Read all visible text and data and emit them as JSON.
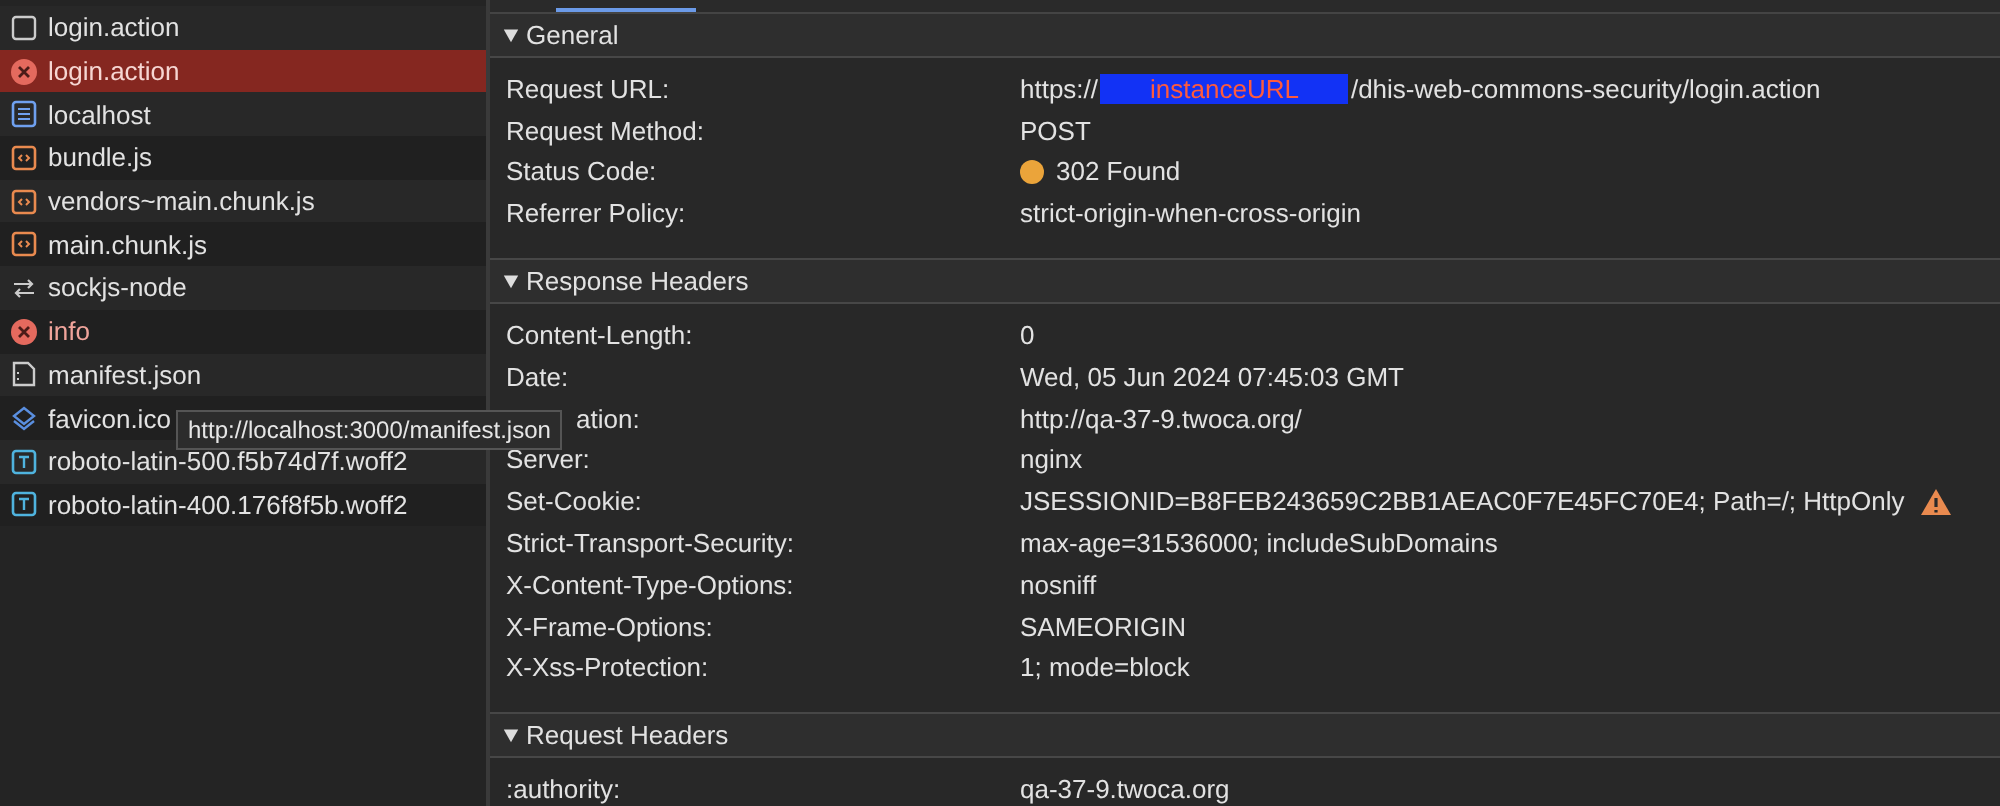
{
  "requests": [
    {
      "name": "login.action",
      "kind": "blank",
      "error": false,
      "selected": false
    },
    {
      "name": "login.action",
      "kind": "error",
      "error": true,
      "selected": true
    },
    {
      "name": "localhost",
      "kind": "document",
      "error": false,
      "selected": false
    },
    {
      "name": "bundle.js",
      "kind": "script",
      "error": false,
      "selected": false
    },
    {
      "name": "vendors~main.chunk.js",
      "kind": "script",
      "error": false,
      "selected": false
    },
    {
      "name": "main.chunk.js",
      "kind": "script",
      "error": false,
      "selected": false
    },
    {
      "name": "sockjs-node",
      "kind": "websocket",
      "error": false,
      "selected": false
    },
    {
      "name": "info",
      "kind": "error",
      "error": true,
      "selected": false
    },
    {
      "name": "manifest.json",
      "kind": "manifest",
      "error": false,
      "selected": false
    },
    {
      "name": "favicon.ico",
      "kind": "layers",
      "error": false,
      "selected": false
    },
    {
      "name": "roboto-latin-500.f5b74d7f.woff2",
      "kind": "font",
      "error": false,
      "selected": false
    },
    {
      "name": "roboto-latin-400.176f8f5b.woff2",
      "kind": "font",
      "error": false,
      "selected": false
    }
  ],
  "tooltip": "http://localhost:3000/manifest.json",
  "sections": [
    {
      "title": "General",
      "expanded": true,
      "rows": [
        {
          "label": "Request URL:",
          "segments": [
            {
              "text": "https://",
              "redacted": false
            },
            {
              "text": "instanceURL",
              "redacted": true
            },
            {
              "text": "/dhis-web-commons-security/login.action",
              "redacted": false
            }
          ]
        },
        {
          "label": "Request Method:",
          "value": "POST"
        },
        {
          "label": "Status Code:",
          "value": "302 Found",
          "color": "#eba43a"
        },
        {
          "label": "Referrer Policy:",
          "value": "strict-origin-when-cross-origin"
        }
      ]
    },
    {
      "title": "Response Headers",
      "expanded": true,
      "rows": [
        {
          "label": "Content-Length:",
          "value": "0"
        },
        {
          "label": "Date:",
          "value": "Wed, 05 Jun 2024 07:45:03 GMT"
        },
        {
          "label": "ation:",
          "value": "http://qa-37-9.twoca.org/",
          "obscured": true
        },
        {
          "label": "Server:",
          "value": "nginx"
        },
        {
          "label": "Set-Cookie:",
          "value": "JSESSIONID=B8FEB243659C2BB1AEAC0F7E45FC70E4; Path=/; HttpOnly",
          "warning": true
        },
        {
          "label": "Strict-Transport-Security:",
          "value": "max-age=31536000; includeSubDomains"
        },
        {
          "label": "X-Content-Type-Options:",
          "value": "nosniff"
        },
        {
          "label": "X-Frame-Options:",
          "value": "SAMEORIGIN"
        },
        {
          "label": "X-Xss-Protection:",
          "value": "1; mode=block"
        }
      ]
    },
    {
      "title": "Request Headers",
      "expanded": true,
      "rows": [
        {
          "label": ":authority:",
          "value": "qa-37-9.twoca.org"
        }
      ]
    }
  ]
}
